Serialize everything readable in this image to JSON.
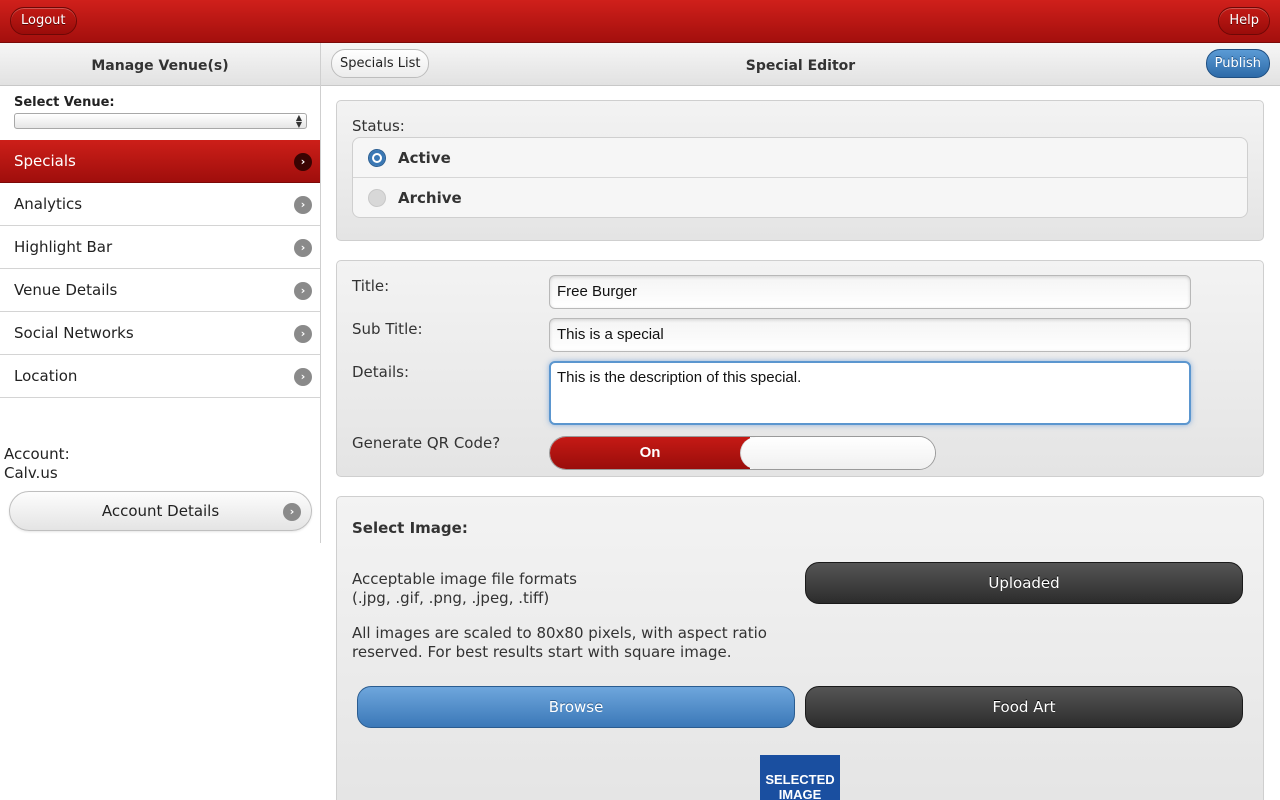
{
  "header": {
    "logout_label": "Logout",
    "help_label": "Help"
  },
  "sidebar": {
    "title": "Manage Venue(s)",
    "select_venue_label": "Select Venue:",
    "select_venue_value": "",
    "items": [
      {
        "label": "Specials",
        "active": true
      },
      {
        "label": "Analytics",
        "active": false
      },
      {
        "label": "Highlight Bar",
        "active": false
      },
      {
        "label": "Venue Details",
        "active": false
      },
      {
        "label": "Social Networks",
        "active": false
      },
      {
        "label": "Location",
        "active": false
      }
    ],
    "account_label": "Account:",
    "account_name": "Calv.us",
    "account_details_label": "Account Details"
  },
  "editor": {
    "specials_list_label": "Specials List",
    "title": "Special Editor",
    "publish_label": "Publish",
    "status": {
      "label": "Status:",
      "options": [
        {
          "label": "Active",
          "selected": true
        },
        {
          "label": "Archive",
          "selected": false
        }
      ]
    },
    "form": {
      "title_label": "Title:",
      "title_value": "Free Burger",
      "subtitle_label": "Sub Title:",
      "subtitle_value": "This is a special",
      "details_label": "Details:",
      "details_value": "This is the description of this special.",
      "qr_label": "Generate QR Code?",
      "qr_value": "On"
    },
    "image": {
      "select_label": "Select Image:",
      "formats_line1": "Acceptable image file formats",
      "formats_line2": "(.jpg, .gif, .png, .jpeg, .tiff)",
      "scaled_line1": "All images are scaled to 80x80 pixels, with aspect ratio",
      "scaled_line2": "reserved. For best results start with square image.",
      "uploaded_label": "Uploaded",
      "browse_label": "Browse",
      "food_art_label": "Food Art",
      "selected_image_line1": "SELECTED",
      "selected_image_line2": "IMAGE"
    }
  },
  "colors": {
    "brand_red": "#b8170f",
    "accent_blue": "#3a78b5",
    "dark_button": "#3a3a3a"
  }
}
